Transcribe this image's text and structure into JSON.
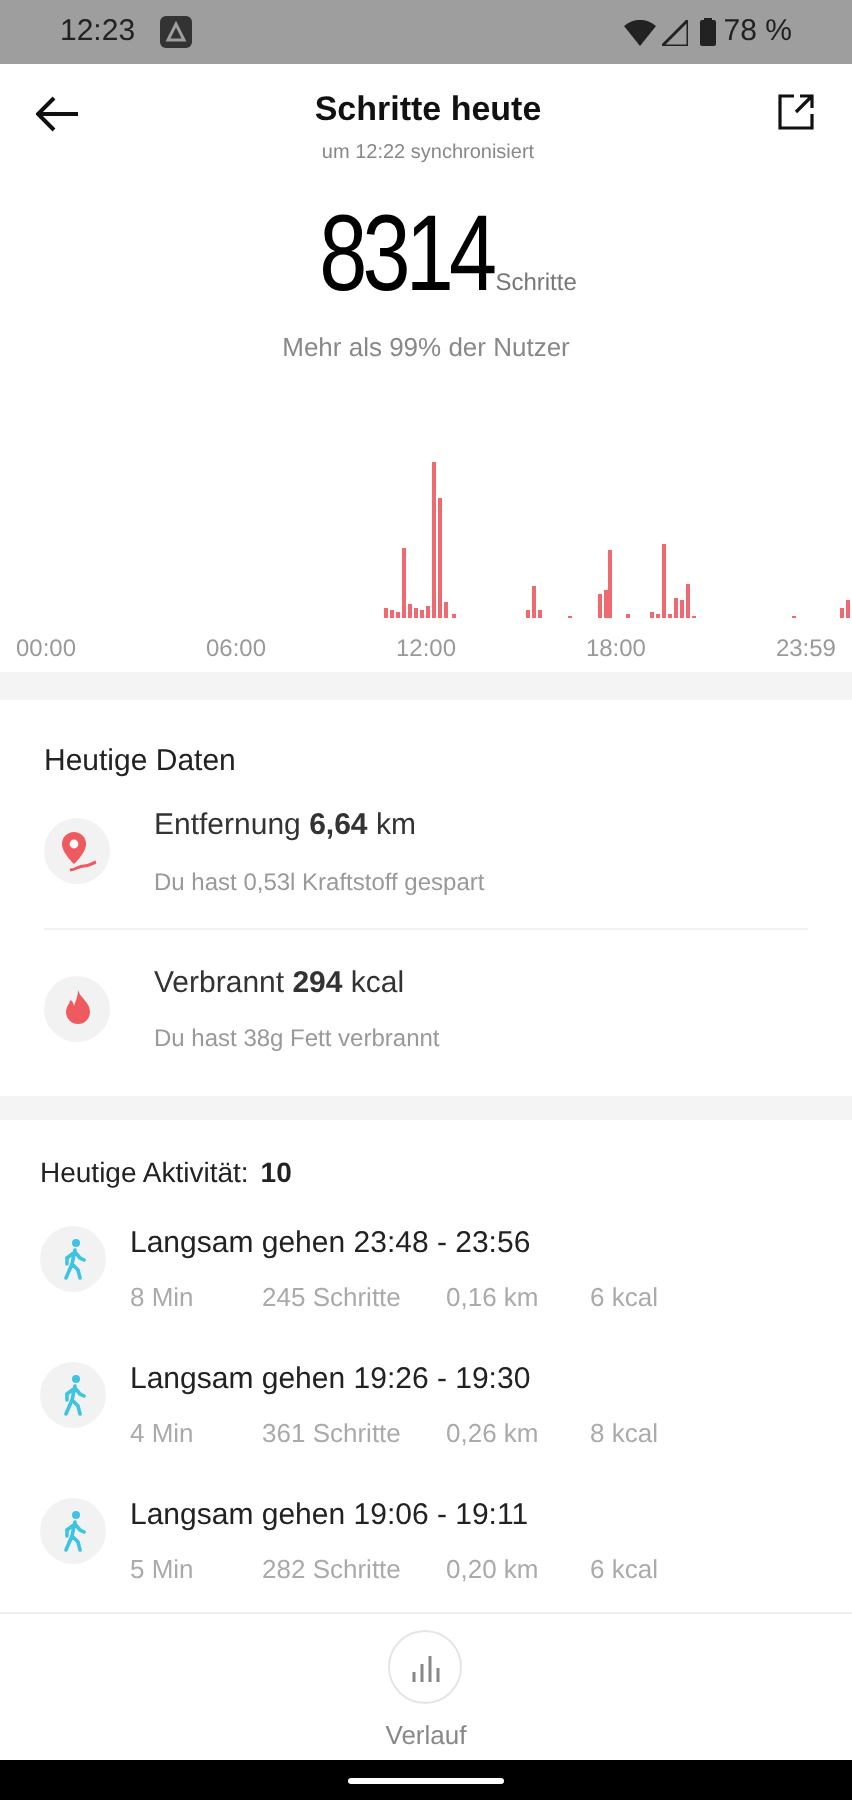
{
  "status_bar": {
    "time": "12:23",
    "battery": "78 %"
  },
  "header": {
    "title": "Schritte heute",
    "subtitle": "um 12:22 synchronisiert"
  },
  "summary": {
    "steps": "8314",
    "unit": "Schritte",
    "comparison": "Mehr als 99% der Nutzer"
  },
  "chart": {
    "x_labels": [
      "00:00",
      "06:00",
      "12:00",
      "18:00",
      "23:59"
    ]
  },
  "today_data": {
    "title": "Heutige Daten",
    "items": [
      {
        "kind": "distance",
        "label": "Entfernung",
        "value": "6,64",
        "unit": "km",
        "note": "Du hast 0,53l Kraftstoff gespart"
      },
      {
        "kind": "calories",
        "label": "Verbrannt",
        "value": "294",
        "unit": "kcal",
        "note": "Du hast 38g Fett verbrannt"
      }
    ]
  },
  "activities": {
    "title": "Heutige Aktivität:",
    "count": "10",
    "items": [
      {
        "title": "Langsam gehen 23:48 - 23:56",
        "duration": "8 Min",
        "steps": "245",
        "steps_unit": "Schritte",
        "distance": "0,16 km",
        "calories": "6 kcal"
      },
      {
        "title": "Langsam gehen 19:26 - 19:30",
        "duration": "4 Min",
        "steps": "361",
        "steps_unit": "Schritte",
        "distance": "0,26 km",
        "calories": "8 kcal"
      },
      {
        "title": "Langsam gehen 19:06 - 19:11",
        "duration": "5 Min",
        "steps": "282",
        "steps_unit": "Schritte",
        "distance": "0,20 km",
        "calories": "6 kcal"
      }
    ]
  },
  "bottom_nav": {
    "label": "Verlauf"
  }
}
